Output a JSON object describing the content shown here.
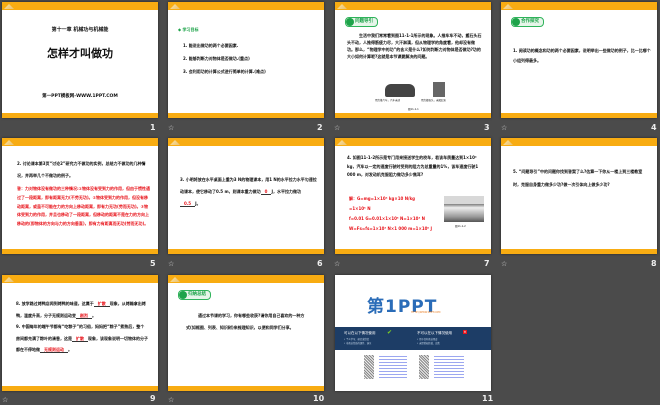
{
  "slides": [
    {
      "num": "1",
      "chapter": "第十一章  机械功与机械能",
      "title": "怎样才叫做功",
      "footer": "第一PPT模板网-WWW.1PPT.COM"
    },
    {
      "num": "2",
      "heading": "◆ 学习目标",
      "items": [
        "1. 能说出做功的两个必要因素.",
        "2. 能够判断力对物体是否做功.(重点)",
        "3. 会利用功的计算公式进行简单的计算.(难点)"
      ]
    },
    {
      "num": "3",
      "badge": "问题导引",
      "body": "生活中我们常常看到图11-1-1所示的现象。人推车车不动，搬石头石头不动，人推得筋疲力尽，大汗淋漓，但从物理学的角度看，他却没有做功。那么，“物理学中的功”的含义是什么?如何判断力对物体是否做功?功的大小如何计算呢?这就是本节课要解决的问题。",
      "captions": [
        "用力推汽车，汽车未动",
        "用力搬石头，未搬起来"
      ],
      "figure": "图11-1-1"
    },
    {
      "num": "4",
      "badge": "合作探究",
      "body": "1. 阅读功的概念和功的两个必要因素，说明举出一些做功的例子，比一比哪个小组列得最多。"
    },
    {
      "num": "5",
      "question": "2. 讨论课本第3页“讨论2”研究力不做功的实例，总结力不做功的几种情况，并再举几个不做功的例子。",
      "answer": "答：力对物体没有做功的三种情况:①物体没有受到力的作用，但由于惯性通过了一段距离，即有距离无力(不劳无功)。②物体受到力的作用，但没有移动距离，或虽不可能在力的方向上移动距离，即有力无功(劳而无功)。③物体受到力的作用，并且也移动了一段距离，但移动的距离不是在力的方向上移动的(即物体的方向与力的方向垂直)，即有力有距离而无功(劳而无功)。"
    },
    {
      "num": "6",
      "q1": "3. 小明将放在水平桌面上重为3 N的物理课本，用1 N的水平拉力水平匀速拉动课本，使它移动了0.5 m，则课本重力做功",
      "a1": "0",
      "q2": "J，水平拉力做功",
      "a2": "0.5",
      "q3": "J。"
    },
    {
      "num": "7",
      "question": "4. 如图11-1-2所示是专门用来接送学生的校车，若该车质量达到1×10⁴ kg，汽车以一定的速度行驶时受到的阻力为总重量的1%，该车速度行驶1 000 m，对发动机克服阻力做功多少焦耳?",
      "answer": [
        "解：G=mg=1×10⁴ kg×10 N/kg",
        "=1×10⁵ N",
        "f=0.01 G=0.01×1×10⁵ N=1×10³ N",
        "W=Fs=fs=1×10³ N×1 000 m=1×10⁶ J"
      ],
      "figure": "图11-1-2"
    },
    {
      "num": "8",
      "body": "5. “问题导引”中的问题你找到答案了么?估算一下你从一楼上到三楼教室时，克服自身重力做多少功?做一次引体向上做多少功?"
    },
    {
      "num": "9",
      "p1a": "8. 放学路过烤鸭店闻到烤鸭的味道，这属于",
      "a1": "扩散",
      "p1b": "现象，从烤箱拿出烤鸭，温度升高，分子无规则运动变",
      "a2": "剧烈",
      "p1c": "。",
      "p2a": "9. 中国每年的端午节都有“吃粽子”的习俗，妈妈把“粽子”煮熟后，整个房间都充满了粽叶的清香，这是",
      "a3": "扩散",
      "p2b": "现象，该现象说明一切物体的分子都在不停地做",
      "a4": "无规则运动",
      "p2c": "。"
    },
    {
      "num": "10",
      "badge": "归纳总结",
      "body": "通过本节课的学习，你有哪些收获?请你用自己喜欢的一种方式(如框图、列表、知识树)来梳理知识，以便和同学们分享。"
    },
    {
      "num": "11",
      "logo": "第1PPT",
      "url": "HTTP://WWW.1PPT.COM",
      "can": "可以在以下情况使用",
      "cannot": "不可以在以下情况使用",
      "can_items": [
        "• 个人学习、研究或欣赏",
        "• 非商业性质的课件、演示"
      ],
      "cannot_items": [
        "• 用于任何商业用途",
        "• 未经授权转载、出售"
      ]
    }
  ],
  "star": "☆"
}
